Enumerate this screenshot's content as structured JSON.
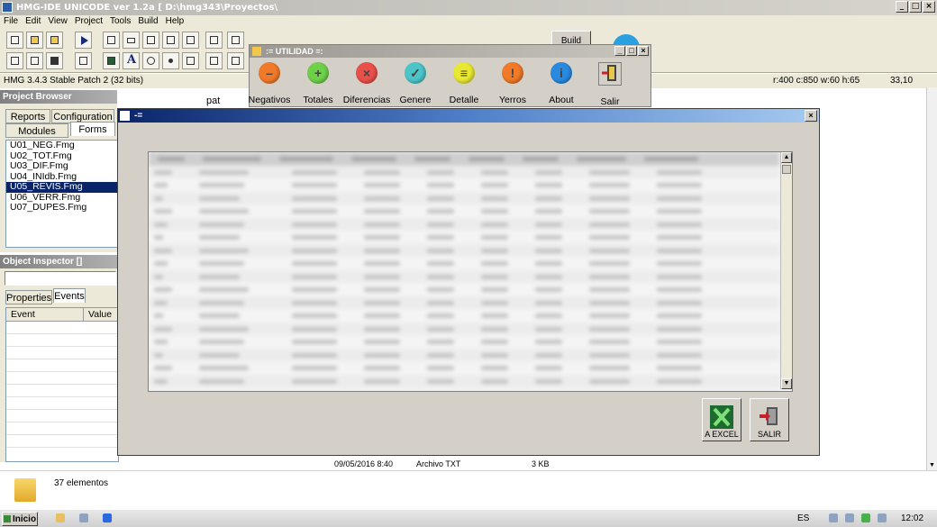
{
  "ide": {
    "title": "HMG-IDE  UNICODE  ver 1.2a  [ D:\\hmg343\\Proyectos\\ ",
    "menu": [
      "File",
      "Edit",
      "View",
      "Project",
      "Tools",
      "Build",
      "Help"
    ],
    "build_label": "Build",
    "status_version": "HMG 3.4.3 Stable Patch 2 (32 bits)",
    "status_geometry": "r:400 c:850 w:60 h:65",
    "status_pos": "33,10"
  },
  "project_browser": {
    "title": "Project Browser",
    "tabs": [
      "Reports",
      "Configuration",
      "Modules",
      "Forms"
    ],
    "files": [
      "U01_NEG.Fmg",
      "U02_TOT.Fmg",
      "U03_DIF.Fmg",
      "U04_INIdb.Fmg",
      "U05_REVIS.Fmg",
      "U06_VERR.Fmg",
      "U07_DUPES.Fmg"
    ],
    "selected_index": 4
  },
  "object_inspector": {
    "title": "Object Inspector []",
    "tabs": [
      "Properties",
      "Events"
    ],
    "columns": [
      "Event",
      "Value"
    ]
  },
  "behind_text": "pat",
  "utility": {
    "title": ":= UTILIDAD =:",
    "items": [
      {
        "label": "Negativos",
        "glyph": "–",
        "color": "#f07a2a"
      },
      {
        "label": "Totales",
        "glyph": "+",
        "color": "#6fd04a"
      },
      {
        "label": "Diferencias",
        "glyph": "×",
        "color": "#e8504a"
      },
      {
        "label": "Genere",
        "glyph": "✓",
        "color": "#4cc4c8"
      },
      {
        "label": "Detalle",
        "glyph": "≡",
        "color": "#e8e830"
      },
      {
        "label": "Yerros",
        "glyph": "!",
        "color": "#f07a2a"
      },
      {
        "label": "About",
        "glyph": "i",
        "color": "#2a8ae0"
      },
      {
        "label": "Salir",
        "glyph": "",
        "color": "#d4d0c8"
      }
    ]
  },
  "dialog": {
    "title": "-=",
    "excel_label": "A EXCEL",
    "salir_label": "SALIR"
  },
  "file_row": {
    "date": "09/05/2016 8:40",
    "type": "Archivo TXT",
    "size": "3 KB"
  },
  "explorer": {
    "count": "37 elementos"
  },
  "taskbar": {
    "start": "Inicio",
    "lang": "ES",
    "time": "12:02"
  }
}
